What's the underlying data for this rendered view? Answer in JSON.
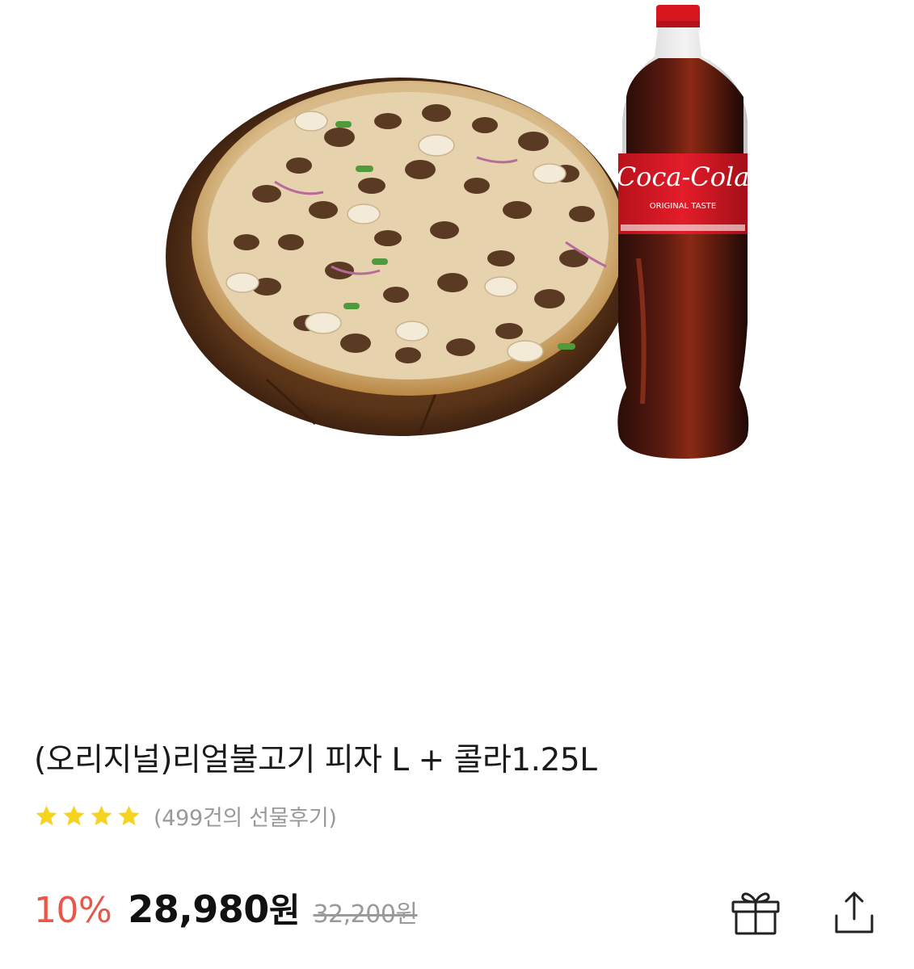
{
  "product": {
    "image_alt": "리얼불고기 피자와 코카콜라",
    "title": "(오리지널)리얼불고기 피자 L + 콜라1.25L",
    "rating_stars": 4,
    "review_count_text": "(499건의 선물후기)",
    "discount_text": "10%",
    "price_text": "28,980",
    "price_unit": "원",
    "original_price_text": "32,200원"
  },
  "actions": {
    "gift_icon": "gift-icon",
    "share_icon": "share-icon"
  },
  "colors": {
    "discount": "#e8584a",
    "star": "#f6d31f",
    "text_primary": "#111111",
    "text_muted": "#999999"
  }
}
